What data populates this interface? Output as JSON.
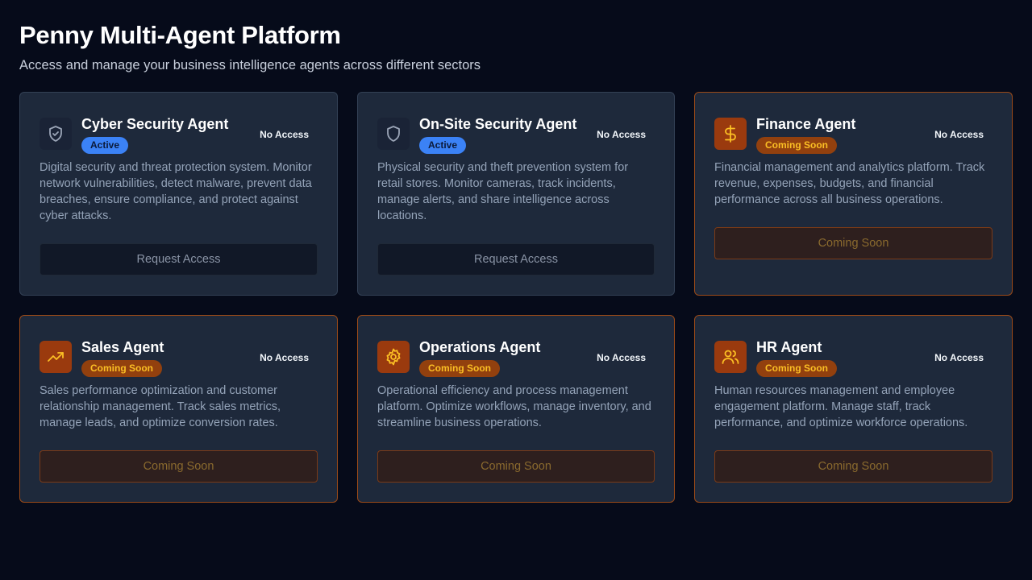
{
  "header": {
    "title": "Penny Multi-Agent Platform",
    "subtitle": "Access and manage your business intelligence agents across different sectors"
  },
  "colors": {
    "background": "#060b1a",
    "card": "#1e293b",
    "active_badge": "#3b82f6",
    "soon_badge": "#92400e",
    "soon_border": "#9a4a18"
  },
  "agents": [
    {
      "title": "Cyber Security Agent",
      "icon": "shield-check-icon",
      "status": "Active",
      "access": "No Access",
      "description": "Digital security and threat protection system. Monitor network vulnerabilities, detect malware, prevent data breaches, ensure compliance, and protect against cyber attacks.",
      "button": "Request Access"
    },
    {
      "title": "On-Site Security Agent",
      "icon": "shield-icon",
      "status": "Active",
      "access": "No Access",
      "description": "Physical security and theft prevention system for retail stores. Monitor cameras, track incidents, manage alerts, and share intelligence across locations.",
      "button": "Request Access"
    },
    {
      "title": "Finance Agent",
      "icon": "dollar-icon",
      "status": "Coming Soon",
      "access": "No Access",
      "description": "Financial management and analytics platform. Track revenue, expenses, budgets, and financial performance across all business operations.",
      "button": "Coming Soon"
    },
    {
      "title": "Sales Agent",
      "icon": "trending-up-icon",
      "status": "Coming Soon",
      "access": "No Access",
      "description": "Sales performance optimization and customer relationship management. Track sales metrics, manage leads, and optimize conversion rates.",
      "button": "Coming Soon"
    },
    {
      "title": "Operations Agent",
      "icon": "gear-icon",
      "status": "Coming Soon",
      "access": "No Access",
      "description": "Operational efficiency and process management platform. Optimize workflows, manage inventory, and streamline business operations.",
      "button": "Coming Soon"
    },
    {
      "title": "HR Agent",
      "icon": "users-icon",
      "status": "Coming Soon",
      "access": "No Access",
      "description": "Human resources management and employee engagement platform. Manage staff, track performance, and optimize workforce operations.",
      "button": "Coming Soon"
    }
  ]
}
